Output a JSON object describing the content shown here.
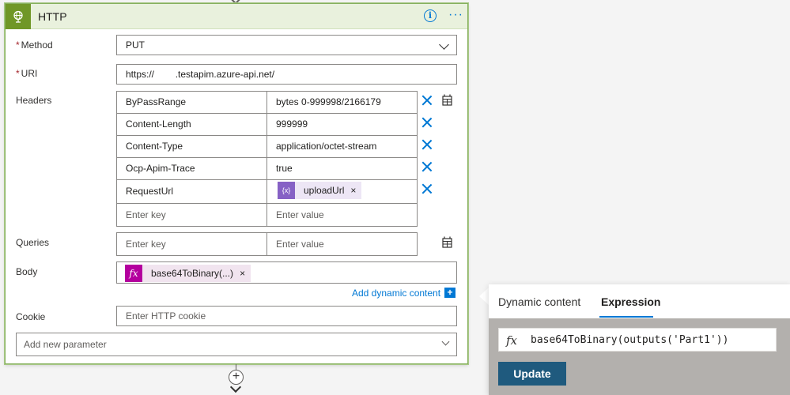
{
  "card": {
    "title": "HTTP",
    "header_color": "#e9f1dd",
    "icon_color": "#709727",
    "info_icon": "info-icon",
    "more_icon": "ellipsis-icon"
  },
  "method": {
    "label": "Method",
    "required": "*",
    "value": "PUT"
  },
  "uri": {
    "label": "URI",
    "required": "*",
    "value": "https://        .testapim.azure-api.net/"
  },
  "headers": {
    "label": "Headers",
    "rows": [
      {
        "key": "ByPassRange",
        "value": "bytes 0-999998/2166179"
      },
      {
        "key": "Content-Length",
        "value": "999999"
      },
      {
        "key": "Content-Type",
        "value": "application/octet-stream"
      },
      {
        "key": "Ocp-Apim-Trace",
        "value": "true"
      },
      {
        "key": "RequestUrl",
        "token": {
          "label": "uploadUrl",
          "icon": "{x}",
          "close": "×"
        }
      }
    ],
    "key_placeholder": "Enter key",
    "value_placeholder": "Enter value"
  },
  "queries": {
    "label": "Queries",
    "key_placeholder": "Enter key",
    "value_placeholder": "Enter value"
  },
  "body": {
    "label": "Body",
    "token": {
      "label": "base64ToBinary(...)",
      "icon": "fx",
      "close": "×"
    },
    "add_dynamic": "Add dynamic content",
    "add_dynamic_icon": "+"
  },
  "cookie": {
    "label": "Cookie",
    "placeholder": "Enter HTTP cookie"
  },
  "add_param": {
    "placeholder": "Add new parameter"
  },
  "add_step": {
    "icon": "+"
  },
  "popup": {
    "tabs": [
      "Dynamic content",
      "Expression"
    ],
    "active_tab": "Expression",
    "expression_prefix": "fx",
    "expression": "base64ToBinary(outputs('Part1'))",
    "update_label": "Update",
    "update_color": "#1f5a7e"
  }
}
